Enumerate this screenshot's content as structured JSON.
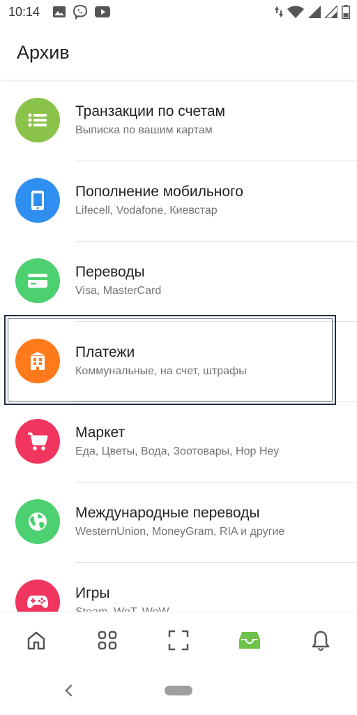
{
  "status_bar": {
    "time": "10:14",
    "left_icons": [
      "image-icon",
      "viber-icon",
      "youtube-icon"
    ],
    "right_icons": [
      "data-arrows-icon",
      "wifi-icon",
      "signal-icon",
      "signal-icon",
      "battery-icon"
    ]
  },
  "header": {
    "title": "Архив"
  },
  "menu": {
    "items": [
      {
        "title": "Транзакции по счетам",
        "subtitle": "Выписка по вашим картам",
        "icon": "list-icon",
        "color": "#8bc34a"
      },
      {
        "title": "Пополнение мобильного",
        "subtitle": "Lifecell, Vodafone, Киевстар",
        "icon": "phone-icon",
        "color": "#2f8ff0"
      },
      {
        "title": "Переводы",
        "subtitle": "Visa, MasterCard",
        "icon": "card-icon",
        "color": "#4cd070"
      },
      {
        "title": "Платежи",
        "subtitle": "Коммунальные, на счет, штрафы",
        "icon": "building-icon",
        "color": "#ff7a1a"
      },
      {
        "title": "Маркет",
        "subtitle": "Еда, Цветы, Вода, Зоотовары, Hop Hey",
        "icon": "cart-icon",
        "color": "#f0355f"
      },
      {
        "title": "Международные переводы",
        "subtitle": "WesternUnion, MoneyGram, RIA и другие",
        "icon": "globe-icon",
        "color": "#4cd070"
      },
      {
        "title": "Игры",
        "subtitle": "Steam, WoT, WoW",
        "icon": "gamepad-icon",
        "color": "#f0355f"
      }
    ]
  },
  "bottom_nav": {
    "items": [
      "home-icon",
      "grid-icon",
      "scan-icon",
      "archive-icon",
      "bell-icon"
    ],
    "active_index": 3,
    "active_color": "#6cc24a",
    "inactive_color": "#555555"
  }
}
